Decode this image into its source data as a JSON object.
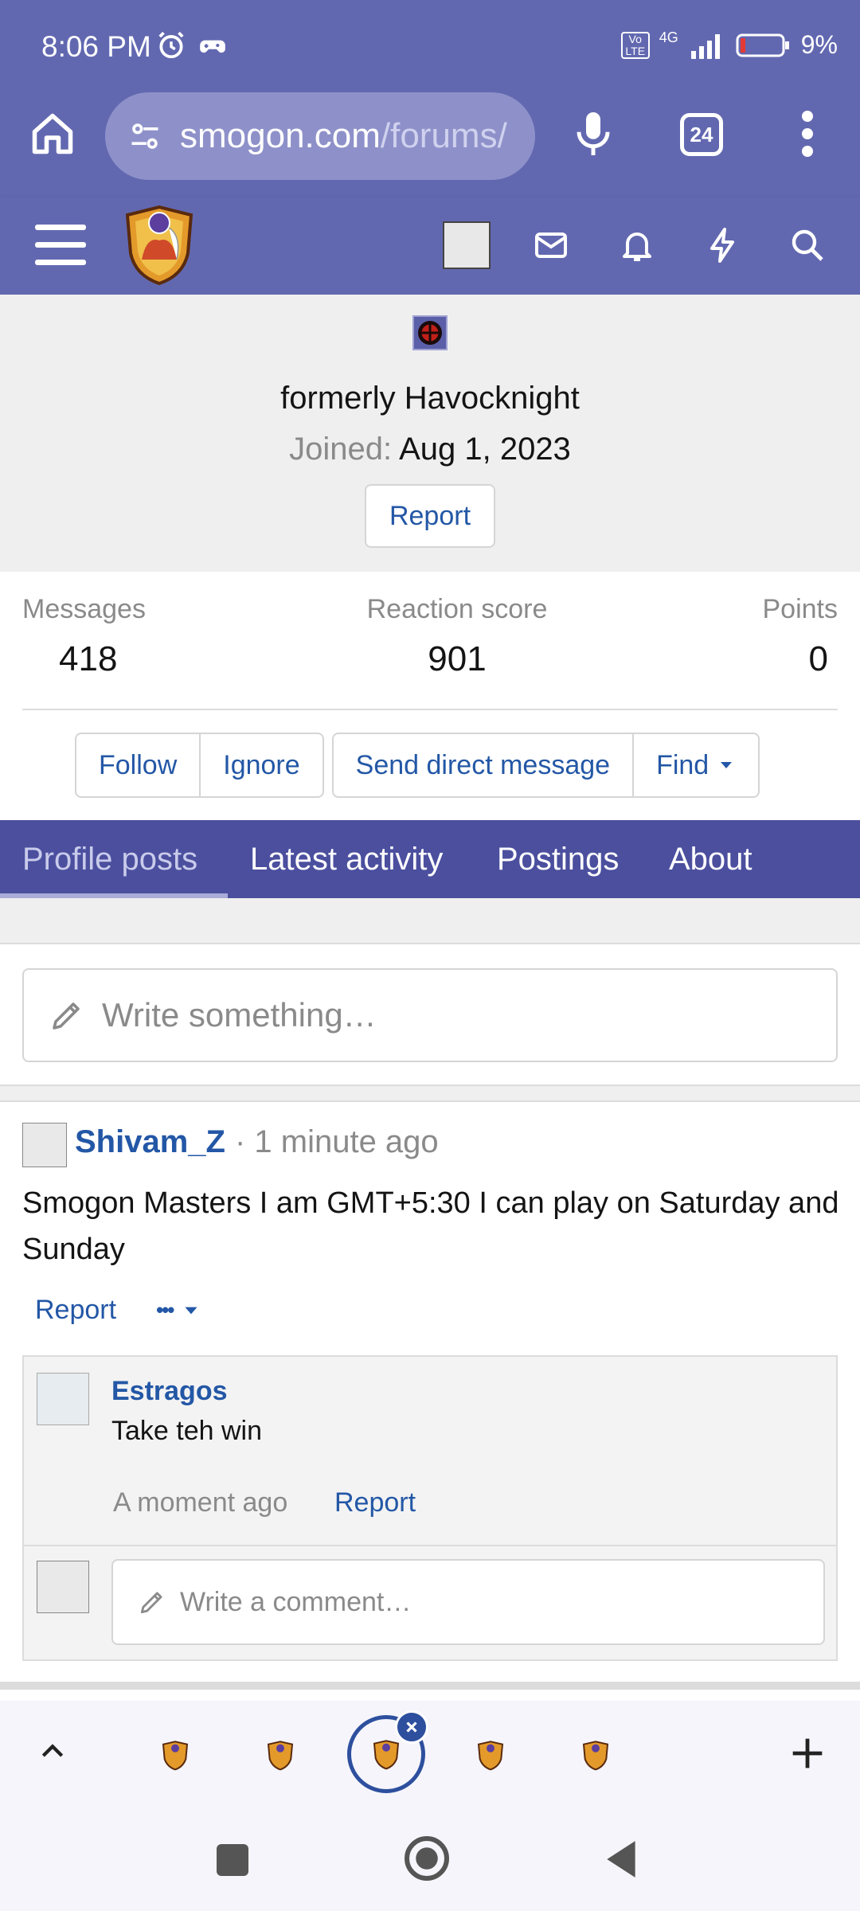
{
  "status_bar": {
    "time": "8:06 PM",
    "network": "4G",
    "volte": "Vo LTE",
    "battery": "9%"
  },
  "browser": {
    "url_domain": "smogon.com",
    "url_path": "/forums/",
    "tab_count": "24"
  },
  "profile": {
    "tagline": "formerly Havocknight",
    "joined_label": "Joined:",
    "joined_date": "Aug 1, 2023",
    "report_label": "Report"
  },
  "stats": {
    "messages_label": "Messages",
    "messages_value": "418",
    "reaction_label": "Reaction score",
    "reaction_value": "901",
    "points_label": "Points",
    "points_value": "0"
  },
  "actions": {
    "follow": "Follow",
    "ignore": "Ignore",
    "send_dm": "Send direct message",
    "find": "Find"
  },
  "tabs": [
    {
      "label": "Profile posts"
    },
    {
      "label": "Latest activity"
    },
    {
      "label": "Postings"
    },
    {
      "label": "About"
    }
  ],
  "write_placeholder": "Write something…",
  "post": {
    "author": "Shivam_Z",
    "time": "· 1 minute ago",
    "body": "Smogon Masters I am GMT+5:30 I can play on Saturday and Sunday",
    "report_label": "Report",
    "more_label": "•••"
  },
  "comment": {
    "author": "Estragos",
    "text": "Take teh win",
    "time": "A moment ago",
    "report_label": "Report"
  },
  "comment_placeholder": "Write a comment…",
  "colors": {
    "header": "#6268b0",
    "tab_bar": "#4b4f9e",
    "link": "#2357a6"
  }
}
